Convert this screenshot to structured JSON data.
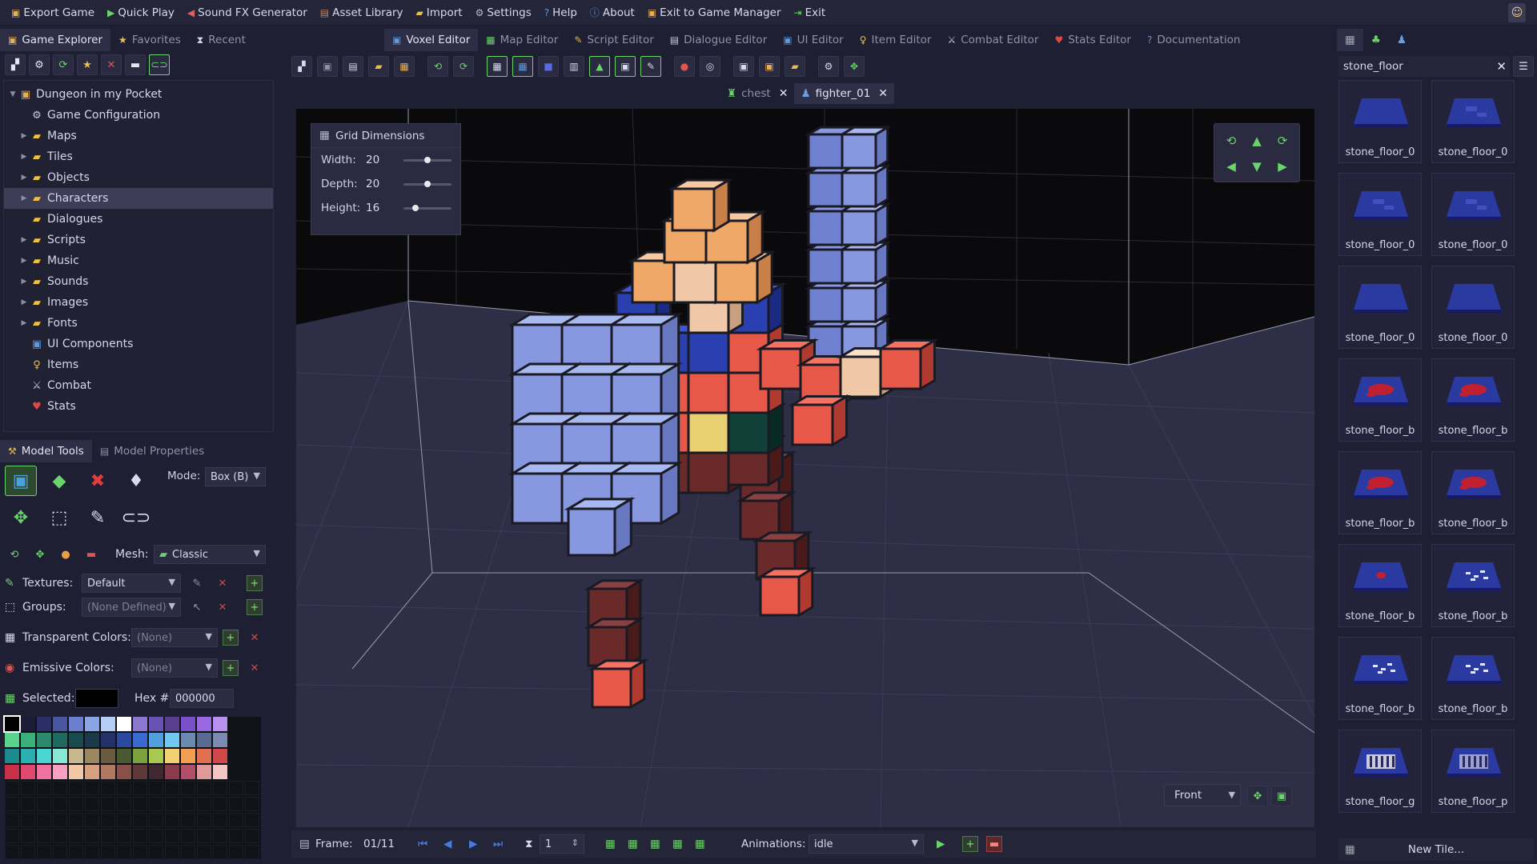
{
  "menu": [
    {
      "label": "Export Game",
      "icon": "export-icon"
    },
    {
      "label": "Quick Play",
      "icon": "play-icon"
    },
    {
      "label": "Sound FX Generator",
      "icon": "speaker-icon"
    },
    {
      "label": "Asset Library",
      "icon": "library-icon"
    },
    {
      "label": "Import",
      "icon": "import-icon"
    },
    {
      "label": "Settings",
      "icon": "settings-icon"
    },
    {
      "label": "Help",
      "icon": "help-icon"
    },
    {
      "label": "About",
      "icon": "info-icon"
    },
    {
      "label": "Exit to Game Manager",
      "icon": "manager-icon"
    },
    {
      "label": "Exit",
      "icon": "exit-icon"
    }
  ],
  "left_tabs": [
    {
      "label": "Game Explorer",
      "active": true
    },
    {
      "label": "Favorites",
      "active": false
    },
    {
      "label": "Recent",
      "active": false
    }
  ],
  "tree": {
    "root": "Dungeon in my Pocket",
    "items": [
      {
        "label": "Game Configuration",
        "kind": "gear"
      },
      {
        "label": "Maps",
        "kind": "folder"
      },
      {
        "label": "Tiles",
        "kind": "folder"
      },
      {
        "label": "Objects",
        "kind": "folder"
      },
      {
        "label": "Characters",
        "kind": "folder",
        "selected": true
      },
      {
        "label": "Dialogues",
        "kind": "folder-plain"
      },
      {
        "label": "Scripts",
        "kind": "folder"
      },
      {
        "label": "Music",
        "kind": "folder"
      },
      {
        "label": "Sounds",
        "kind": "folder"
      },
      {
        "label": "Images",
        "kind": "folder"
      },
      {
        "label": "Fonts",
        "kind": "folder"
      },
      {
        "label": "UI Components",
        "kind": "ui"
      },
      {
        "label": "Items",
        "kind": "key"
      },
      {
        "label": "Combat",
        "kind": "sword"
      },
      {
        "label": "Stats",
        "kind": "heart"
      }
    ]
  },
  "tools_tabs": [
    {
      "label": "Model Tools",
      "active": true
    },
    {
      "label": "Model Properties",
      "active": false
    }
  ],
  "model_tools": {
    "mode_label": "Mode:",
    "mode_value": "Box (B)",
    "mesh_label": "Mesh:",
    "mesh_value": "Classic",
    "textures_label": "Textures:",
    "textures_value": "Default",
    "groups_label": "Groups:",
    "groups_value": "(None Defined)",
    "transparent_label": "Transparent Colors:",
    "transparent_value": "(None)",
    "emissive_label": "Emissive Colors:",
    "emissive_value": "(None)",
    "selected_label": "Selected:",
    "hex_label": "Hex #:",
    "hex_value": "000000"
  },
  "palette": [
    [
      "#000000",
      "#1c1c3a",
      "#2a2f6a",
      "#4a56a0",
      "#6c7ed0",
      "#8aa4e6",
      "#b4cff6",
      "#ffffff",
      "#8c78d0",
      "#6a52b4",
      "#58408e",
      "#7a50c8",
      "#9a68e0",
      "#b890f0"
    ],
    [
      "#5ad48c",
      "#3ab07a",
      "#2a8a6a",
      "#1e6a5e",
      "#184a4e",
      "#1a3a4a",
      "#24306a",
      "#2a4aa0",
      "#3a6ad0",
      "#50a0e0",
      "#70c8f0",
      "#6a8ab0",
      "#5a6a90",
      "#7a8ab0"
    ],
    [
      "#1a8a8a",
      "#2ab0b0",
      "#4ad4d4",
      "#88e8d8",
      "#c8b890",
      "#9a8860",
      "#6a5a40",
      "#4a5a30",
      "#7aa040",
      "#a8c850",
      "#f0d070",
      "#f0a050",
      "#e07050",
      "#d04848"
    ],
    [
      "#c83048",
      "#e04870",
      "#f070a0",
      "#f8a0c0",
      "#f0c8a8",
      "#d8a080",
      "#b07860",
      "#885048",
      "#603838",
      "#402830",
      "#8a3a4a",
      "#b05068",
      "#e09898",
      "#f4c4c0"
    ]
  ],
  "editor_tabs": [
    {
      "label": "Voxel Editor",
      "active": true
    },
    {
      "label": "Map Editor",
      "active": false
    },
    {
      "label": "Script Editor",
      "active": false
    },
    {
      "label": "Dialogue Editor",
      "active": false
    },
    {
      "label": "UI Editor",
      "active": false
    },
    {
      "label": "Item Editor",
      "active": false
    },
    {
      "label": "Combat Editor",
      "active": false
    },
    {
      "label": "Stats Editor",
      "active": false
    },
    {
      "label": "Documentation",
      "active": false
    }
  ],
  "doc_tabs": [
    {
      "label": "chest",
      "active": false
    },
    {
      "label": "fighter_01",
      "active": true
    }
  ],
  "grid_panel": {
    "title": "Grid Dimensions",
    "rows": [
      {
        "label": "Width:",
        "value": "20",
        "fraction": 0.5
      },
      {
        "label": "Depth:",
        "value": "20",
        "fraction": 0.5
      },
      {
        "label": "Height:",
        "value": "16",
        "fraction": 0.25
      }
    ]
  },
  "view_select": "Front",
  "anim_bar": {
    "frame_label": "Frame:",
    "frame_value": "01/11",
    "step_value": "1",
    "animations_label": "Animations:",
    "animation_value": "idle"
  },
  "right": {
    "search_value": "stone_floor",
    "tiles": [
      {
        "name": "stone_floor_0",
        "variant": "plain"
      },
      {
        "name": "stone_floor_0",
        "variant": "cracked"
      },
      {
        "name": "stone_floor_0",
        "variant": "cracked"
      },
      {
        "name": "stone_floor_0",
        "variant": "cracked"
      },
      {
        "name": "stone_floor_0",
        "variant": "plain"
      },
      {
        "name": "stone_floor_0",
        "variant": "plain"
      },
      {
        "name": "stone_floor_b",
        "variant": "blood"
      },
      {
        "name": "stone_floor_b",
        "variant": "blood"
      },
      {
        "name": "stone_floor_b",
        "variant": "blood"
      },
      {
        "name": "stone_floor_b",
        "variant": "blood"
      },
      {
        "name": "stone_floor_b",
        "variant": "blood-small"
      },
      {
        "name": "stone_floor_b",
        "variant": "bones"
      },
      {
        "name": "stone_floor_b",
        "variant": "bones"
      },
      {
        "name": "stone_floor_b",
        "variant": "bones"
      },
      {
        "name": "stone_floor_g",
        "variant": "grate"
      },
      {
        "name": "stone_floor_p",
        "variant": "plate"
      }
    ],
    "new_tile_label": "New Tile..."
  },
  "colors": {
    "accent_green": "#6bd46b",
    "danger_red": "#e05454",
    "folder_gold": "#f0c040"
  }
}
